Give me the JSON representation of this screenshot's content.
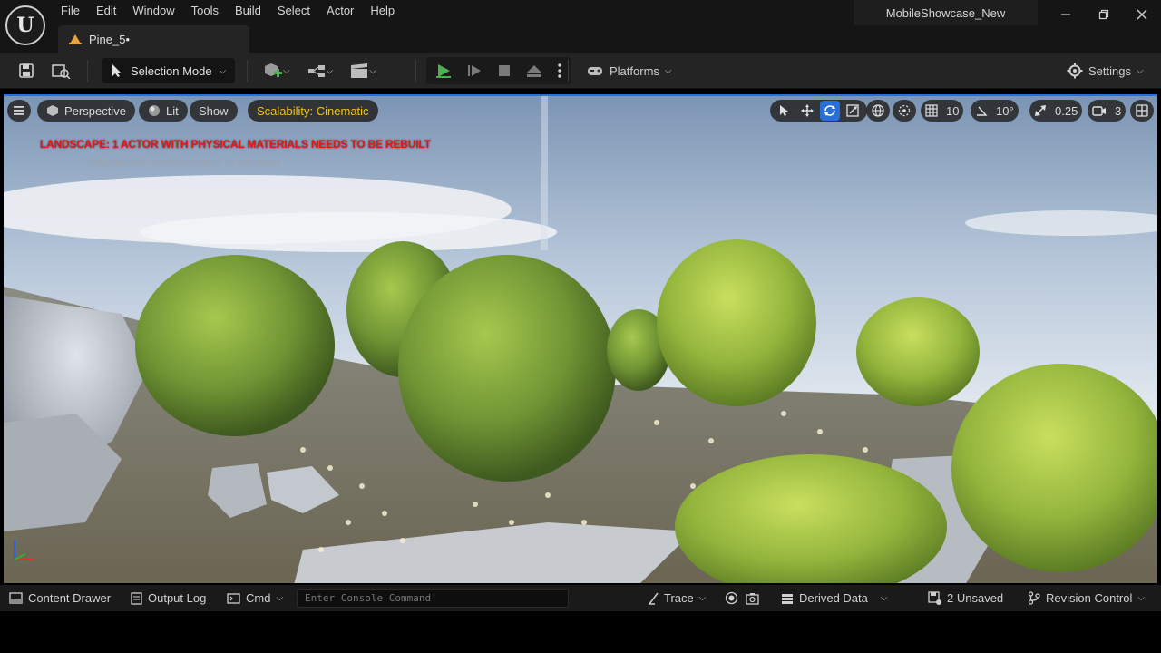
{
  "menu": [
    "File",
    "Edit",
    "Window",
    "Tools",
    "Build",
    "Select",
    "Actor",
    "Help"
  ],
  "logo_text": "U",
  "project_name": "MobileShowcase_New",
  "level_tab": "Pine_5•",
  "toolbar": {
    "selection_mode": "Selection Mode",
    "platforms": "Platforms",
    "settings": "Settings"
  },
  "viewport": {
    "perspective": "Perspective",
    "lit": "Lit",
    "show": "Show",
    "scalability": "Scalability: Cinematic",
    "grid_snap": "10",
    "angle_snap": "10°",
    "scale_snap": "0.25",
    "camera_speed": "3",
    "warning": "LANDSCAPE: 1 ACTOR WITH PHYSICAL MATERIALS NEEDS TO BE REBUILT",
    "suppress": "'DisableAllScreenMessages' to suppress"
  },
  "statusbar": {
    "content_drawer": "Content Drawer",
    "output_log": "Output Log",
    "cmd": "Cmd",
    "console_placeholder": "Enter Console Command",
    "trace": "Trace",
    "derived_data": "Derived Data",
    "unsaved": "2 Unsaved",
    "revision_control": "Revision Control"
  },
  "colors": {
    "accent": "#2a6fd6",
    "warning": "#e01818",
    "scalability": "#f0c419",
    "play": "#4caf50"
  }
}
